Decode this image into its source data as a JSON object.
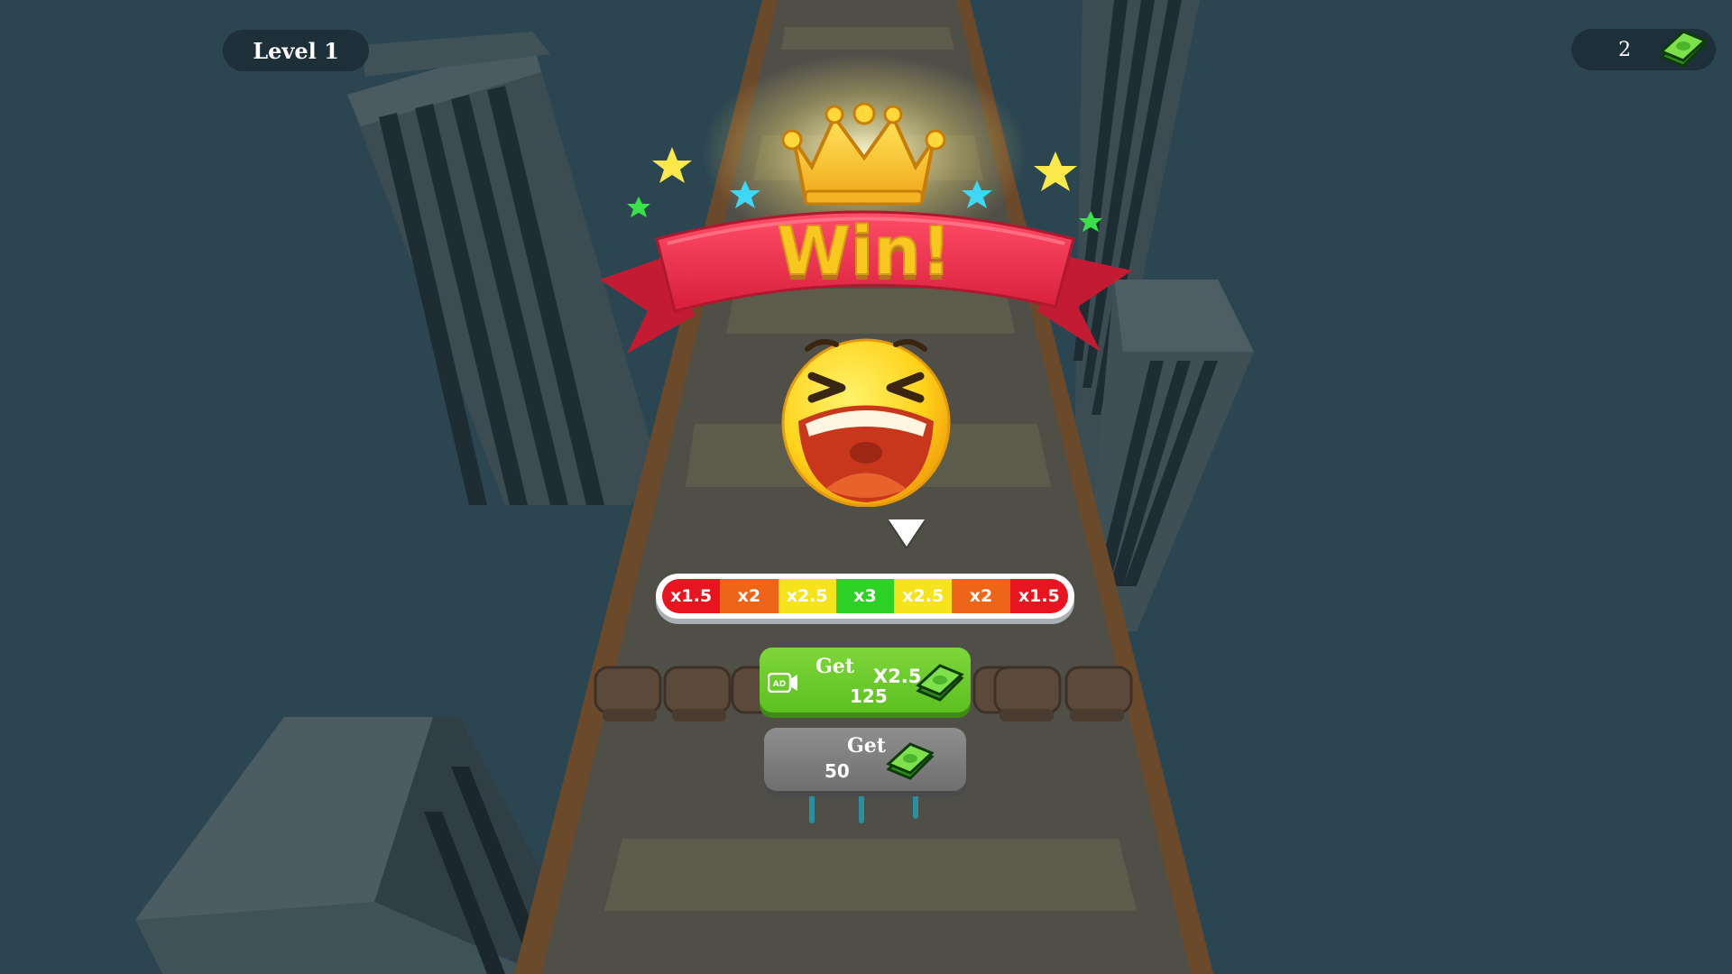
{
  "hud": {
    "level_label": "Level 1",
    "cash_count": "2"
  },
  "result": {
    "title": "Win!"
  },
  "multiplier_bar": {
    "segments": [
      {
        "label": "x1.5",
        "color": "#e8141f"
      },
      {
        "label": "x2",
        "color": "#f06418"
      },
      {
        "label": "x2.5",
        "color": "#f5e31c"
      },
      {
        "label": "x3",
        "color": "#2ed125"
      },
      {
        "label": "x2.5",
        "color": "#f5e31c"
      },
      {
        "label": "x2",
        "color": "#f06418"
      },
      {
        "label": "x1.5",
        "color": "#e8141f"
      }
    ]
  },
  "bonus_button": {
    "title": "Get",
    "multiplier": "X2.5",
    "amount": "125",
    "ad_label": "AD"
  },
  "plain_button": {
    "title": "Get",
    "amount": "50"
  },
  "colors": {
    "background": "#2c4651",
    "banner": "#e32c47",
    "win_text": "#f8c81e",
    "bonus_button": "#6ccb2a",
    "plain_button": "#7d7d7d"
  },
  "icons": [
    "cash-icon",
    "crown-icon",
    "star-icon",
    "ad-video-icon",
    "laughing-emoji"
  ]
}
